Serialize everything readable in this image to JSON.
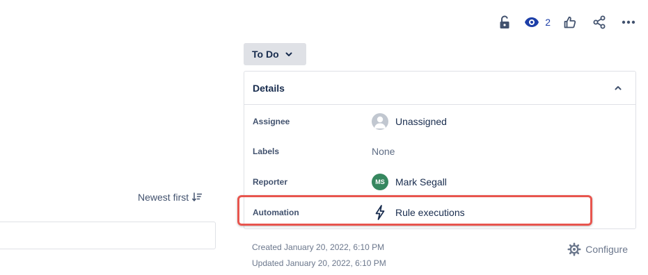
{
  "toolbar": {
    "watch_count": "2",
    "icons": [
      "unlock-icon",
      "eye-icon",
      "thumbs-up-icon",
      "share-icon",
      "more-icon"
    ]
  },
  "status": {
    "label": "To Do"
  },
  "details": {
    "title": "Details",
    "fields": {
      "assignee": {
        "label": "Assignee",
        "value": "Unassigned"
      },
      "labels": {
        "label": "Labels",
        "value": "None"
      },
      "reporter": {
        "label": "Reporter",
        "value": "Mark Segall",
        "initials": "MS"
      },
      "automation": {
        "label": "Automation",
        "value": "Rule executions"
      }
    }
  },
  "meta": {
    "created": "Created January 20, 2022, 6:10 PM",
    "updated": "Updated January 20, 2022, 6:10 PM",
    "configure_label": "Configure"
  },
  "activity": {
    "sort_label": "Newest first"
  },
  "colors": {
    "highlight": "#e8554e",
    "reporter_avatar": "#36875f",
    "watch_accent": "#1d3fa8",
    "status_bg": "#dfe1e6"
  }
}
